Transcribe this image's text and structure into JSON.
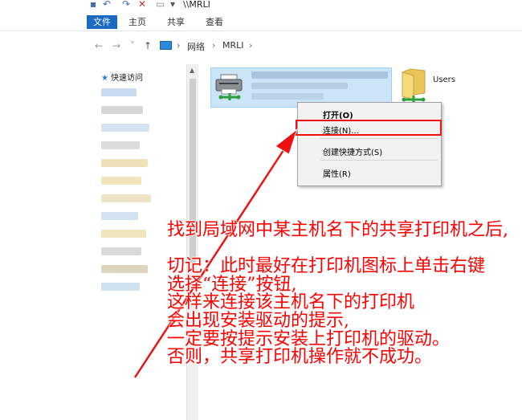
{
  "titlebar": {
    "title": "\\\\MRLI",
    "undo_glyph": "↶",
    "redo_glyph": "↷",
    "close_glyph": "✕",
    "pin_glyph": "▾"
  },
  "ribbon": {
    "tabs": [
      "文件",
      "主页",
      "共享",
      "查看"
    ]
  },
  "address": {
    "back": "←",
    "forward": "→",
    "down": "˅",
    "up": "↑",
    "crumbs": [
      "网络",
      "MRLI"
    ],
    "separators": [
      "›",
      "›",
      "›"
    ]
  },
  "sidebar": {
    "quick_access": "快速访问"
  },
  "content": {
    "users_label": "Users"
  },
  "context_menu": {
    "items": [
      "打开(O)",
      "连接(N)...",
      "创建快捷方式(S)",
      "属性(R)"
    ]
  },
  "annotation": {
    "lines": [
      "找到局域网中某主机名下的共享打印机之后,",
      "",
      "切记：此时最好在打印机图标上单击右键",
      "选择“连接”按钮,",
      "这样来连接该主机名下的打印机",
      "会出现安装驱动的提示,",
      "一定要按提示安装上打印机的驱动。",
      "否则，共享打印机操作就不成功。"
    ],
    "color": "#ff0000"
  }
}
